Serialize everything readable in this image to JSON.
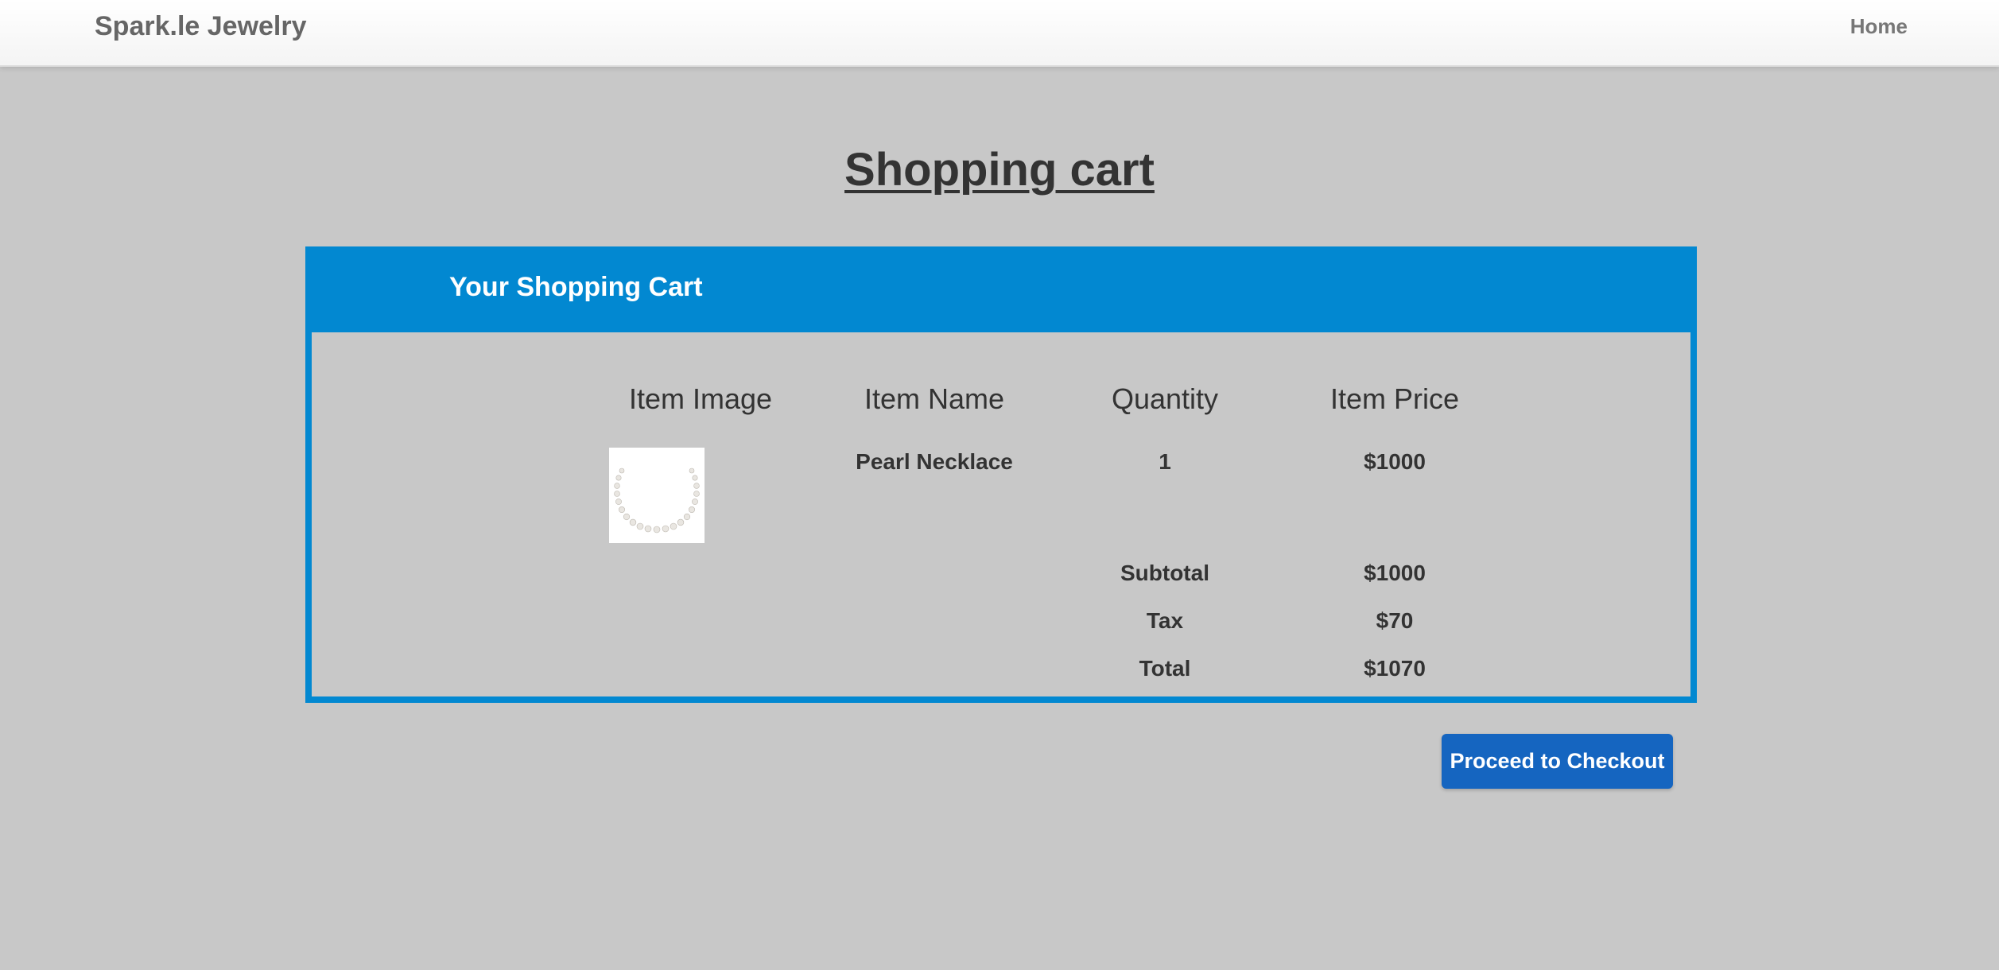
{
  "navbar": {
    "brand": "Spark.le Jewelry",
    "home_link": "Home"
  },
  "page": {
    "title": "Shopping cart"
  },
  "cart": {
    "header_title": "Your Shopping Cart",
    "columns": [
      "Item Image",
      "Item Name",
      "Quantity",
      "Item Price"
    ],
    "items": [
      {
        "image_icon": "pearl-necklace-image",
        "name": "Pearl Necklace",
        "quantity": "1",
        "price": "$1000"
      }
    ],
    "summary": {
      "subtotal_label": "Subtotal",
      "subtotal_value": "$1000",
      "tax_label": "Tax",
      "tax_value": "$70",
      "total_label": "Total",
      "total_value": "$1070"
    }
  },
  "actions": {
    "checkout_label": "Proceed to Checkout"
  },
  "colors": {
    "accent": "#0288d1",
    "button": "#1565c0",
    "background": "#c8c8c8"
  }
}
